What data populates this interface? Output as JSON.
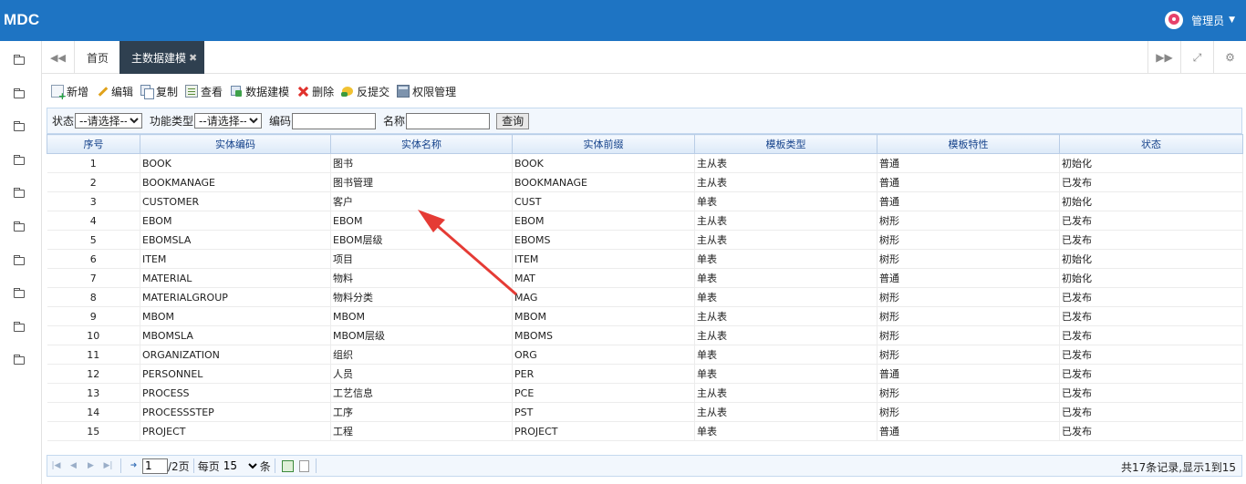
{
  "app": {
    "title": "MDC",
    "user": "管理员"
  },
  "sidebar": {
    "items": [
      "folder",
      "folder",
      "folder",
      "folder",
      "folder",
      "folder",
      "folder",
      "folder",
      "folder",
      "folder"
    ]
  },
  "tabs": {
    "home": "首页",
    "active": "主数据建模"
  },
  "toolbar": [
    {
      "label": "新增",
      "icon": "add-icon"
    },
    {
      "label": "编辑",
      "icon": "edit-icon"
    },
    {
      "label": "复制",
      "icon": "copy-icon"
    },
    {
      "label": "查看",
      "icon": "view-icon"
    },
    {
      "label": "数据建模",
      "icon": "model-icon"
    },
    {
      "label": "删除",
      "icon": "delete-icon"
    },
    {
      "label": "反提交",
      "icon": "unsubmit-icon"
    },
    {
      "label": "权限管理",
      "icon": "permission-icon"
    }
  ],
  "filter": {
    "status_label": "状态",
    "status_value": "--请选择--",
    "type_label": "功能类型",
    "type_value": "--请选择--",
    "code_label": "编码",
    "name_label": "名称",
    "query_label": "查询"
  },
  "table": {
    "headers": [
      "序号",
      "实体编码",
      "实体名称",
      "实体前缀",
      "模板类型",
      "模板特性",
      "状态"
    ],
    "rows": [
      [
        "1",
        "BOOK",
        "图书",
        "BOOK",
        "主从表",
        "普通",
        "初始化"
      ],
      [
        "2",
        "BOOKMANAGE",
        "图书管理",
        "BOOKMANAGE",
        "主从表",
        "普通",
        "已发布"
      ],
      [
        "3",
        "CUSTOMER",
        "客户",
        "CUST",
        "单表",
        "普通",
        "初始化"
      ],
      [
        "4",
        "EBOM",
        "EBOM",
        "EBOM",
        "主从表",
        "树形",
        "已发布"
      ],
      [
        "5",
        "EBOMSLA",
        "EBOM层级",
        "EBOMS",
        "主从表",
        "树形",
        "已发布"
      ],
      [
        "6",
        "ITEM",
        "项目",
        "ITEM",
        "单表",
        "树形",
        "初始化"
      ],
      [
        "7",
        "MATERIAL",
        "物料",
        "MAT",
        "单表",
        "普通",
        "初始化"
      ],
      [
        "8",
        "MATERIALGROUP",
        "物料分类",
        "MAG",
        "单表",
        "树形",
        "已发布"
      ],
      [
        "9",
        "MBOM",
        "MBOM",
        "MBOM",
        "主从表",
        "树形",
        "已发布"
      ],
      [
        "10",
        "MBOMSLA",
        "MBOM层级",
        "MBOMS",
        "主从表",
        "树形",
        "已发布"
      ],
      [
        "11",
        "ORGANIZATION",
        "组织",
        "ORG",
        "单表",
        "树形",
        "已发布"
      ],
      [
        "12",
        "PERSONNEL",
        "人员",
        "PER",
        "单表",
        "普通",
        "已发布"
      ],
      [
        "13",
        "PROCESS",
        "工艺信息",
        "PCE",
        "主从表",
        "树形",
        "已发布"
      ],
      [
        "14",
        "PROCESSSTEP",
        "工序",
        "PST",
        "主从表",
        "树形",
        "已发布"
      ],
      [
        "15",
        "PROJECT",
        "工程",
        "PROJECT",
        "单表",
        "普通",
        "已发布"
      ]
    ]
  },
  "pager": {
    "page": "1",
    "total_pages": "/2页",
    "per_page_label": "每页",
    "per_page": "15",
    "per_page_unit": "条",
    "info": "共17条记录,显示1到15"
  },
  "colors": {
    "topbar": "#1e74c3",
    "active_tab": "#2f4050",
    "header_text": "#15428b",
    "annotation_arrow": "#e53b35"
  }
}
